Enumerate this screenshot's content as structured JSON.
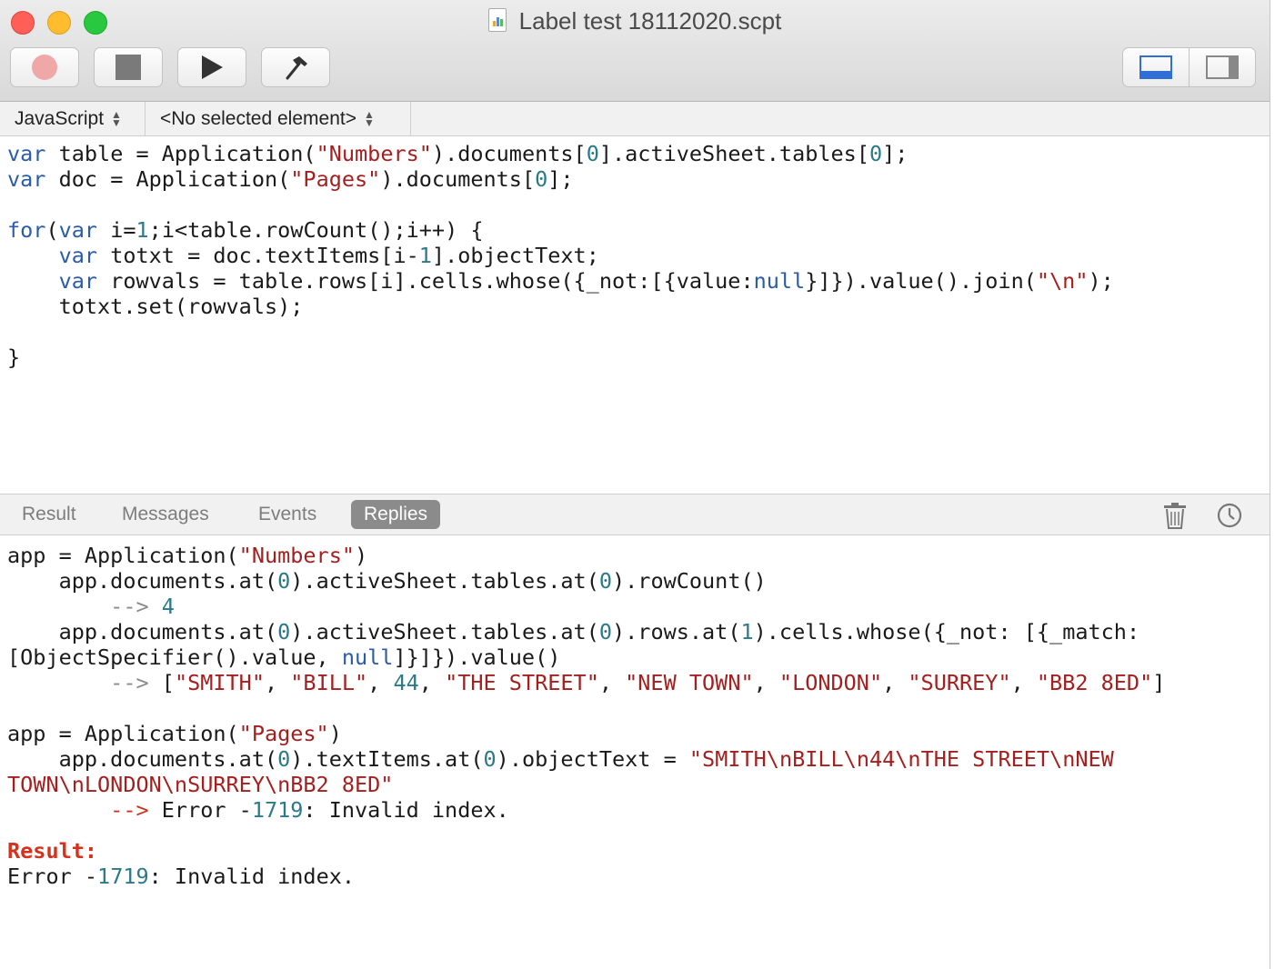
{
  "window": {
    "title": "Label test 18112020.scpt"
  },
  "toolbar": {
    "buttons": [
      {
        "name": "record",
        "icon": "record-icon"
      },
      {
        "name": "stop",
        "icon": "stop-icon"
      },
      {
        "name": "run",
        "icon": "play-icon"
      },
      {
        "name": "compile",
        "icon": "hammer-icon"
      }
    ],
    "view_toggle": [
      "bottom-panel-icon",
      "side-panel-icon"
    ]
  },
  "navbar": {
    "language": "JavaScript",
    "element": "<No selected element>"
  },
  "editor": {
    "l1_kw": "var",
    "l1_a": " table = Application(",
    "l1_s": "\"Numbers\"",
    "l1_b": ").documents[",
    "l1_n1": "0",
    "l1_c": "].activeSheet.tables[",
    "l1_n2": "0",
    "l1_d": "];",
    "l2_kw": "var",
    "l2_a": " doc = Application(",
    "l2_s": "\"Pages\"",
    "l2_b": ").documents[",
    "l2_n": "0",
    "l2_c": "];",
    "l4_kw1": "for",
    "l4_a": "(",
    "l4_kw2": "var",
    "l4_b": " i=",
    "l4_n": "1",
    "l4_c": ";i<table.rowCount();i++) {",
    "l5_ind": "    ",
    "l5_kw": "var",
    "l5_a": " totxt = doc.textItems[i-",
    "l5_n": "1",
    "l5_b": "].objectText;",
    "l6_ind": "    ",
    "l6_kw": "var",
    "l6_a": " rowvals = table.rows[i].cells.whose({_not:[{value:",
    "l6_kw2": "null",
    "l6_b": "}]}).value().join(",
    "l6_s": "\"\\n\"",
    "l6_c": ");",
    "l7": "    totxt.set(rowvals);",
    "l9": "}"
  },
  "panel": {
    "tabs": [
      "Result",
      "Messages",
      "Events",
      "Replies"
    ],
    "active_tab": "Replies",
    "trash_icon": "trash-icon",
    "history_icon": "clock-icon"
  },
  "output": {
    "o1_a": "app = Application(",
    "o1_s": "\"Numbers\"",
    "o1_b": ")",
    "o2_a": "    app.documents.at(",
    "o2_n1": "0",
    "o2_b": ").activeSheet.tables.at(",
    "o2_n2": "0",
    "o2_c": ").rowCount()",
    "o3_arrow": "        --> ",
    "o3_n": "4",
    "o4_a": "    app.documents.at(",
    "o4_n1": "0",
    "o4_b": ").activeSheet.tables.at(",
    "o4_n2": "0",
    "o4_c": ").rows.at(",
    "o4_n3": "1",
    "o4_d": ").cells.whose({_not: [{_match:",
    "o5_a": "[ObjectSpecifier().value, ",
    "o5_kw": "null",
    "o5_b": "]}]}).value()",
    "o6_arrow": "        --> ",
    "o6_a": "[",
    "o6_s1": "\"SMITH\"",
    "o6_sep1": ", ",
    "o6_s2": "\"BILL\"",
    "o6_sep2": ", ",
    "o6_n": "44",
    "o6_sep3": ", ",
    "o6_s3": "\"THE STREET\"",
    "o6_sep4": ", ",
    "o6_s4": "\"NEW TOWN\"",
    "o6_sep5": ", ",
    "o6_s5": "\"LONDON\"",
    "o6_sep6": ", ",
    "o6_s6": "\"SURREY\"",
    "o6_sep7": ", ",
    "o6_s7": "\"BB2 8ED\"",
    "o6_b": "]",
    "o8_a": "app = Application(",
    "o8_s": "\"Pages\"",
    "o8_b": ")",
    "o9_a": "    app.documents.at(",
    "o9_n1": "0",
    "o9_b": ").textItems.at(",
    "o9_n2": "0",
    "o9_c": ").objectText = ",
    "o9_s": "\"SMITH\\nBILL\\n44\\nTHE STREET\\nNEW",
    "o10_s": "TOWN\\nLONDON\\nSURREY\\nBB2 8ED\"",
    "o11_arrow": "        --> ",
    "o11_a": "Error -",
    "o11_n": "1719",
    "o11_b": ": Invalid index.",
    "result_label": "Result:",
    "r_a": "Error -",
    "r_n": "1719",
    "r_b": ": Invalid index."
  },
  "colors": {
    "keyword": "#2a5ca8",
    "string": "#a51f1f",
    "number": "#2a7a8a",
    "error_arrow": "#c8341f",
    "result_label": "#d6311c"
  }
}
